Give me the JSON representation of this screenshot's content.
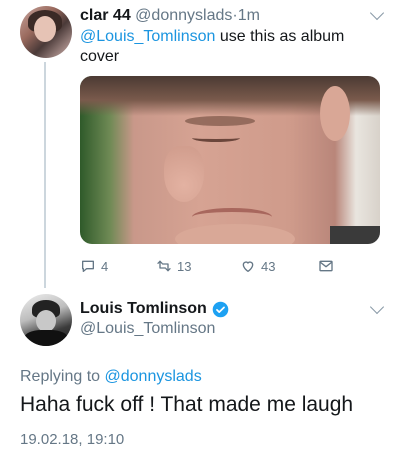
{
  "tweet1": {
    "name": "clar 44",
    "handle": "@donnyslads",
    "separator": "·",
    "time": "1m",
    "mention": "@Louis_Tomlinson",
    "text_line1_rest": " use this as album",
    "text_line2": "cover",
    "counts": {
      "reply": "4",
      "retweet": "13",
      "like": "43"
    }
  },
  "tweet2": {
    "name": "Louis Tomlinson",
    "handle": "@Louis_Tomlinson",
    "replying_prefix": "Replying to ",
    "replying_handle": "@donnyslads",
    "text": "Haha fuck off ! That made me laugh",
    "timestamp": "19.02.18, 19:10"
  },
  "icons": {
    "reply": "reply-icon",
    "retweet": "retweet-icon",
    "like": "heart-icon",
    "dm": "envelope-icon",
    "verified": "verified-badge-icon",
    "menu": "chevron-down-icon"
  },
  "colors": {
    "accent": "#1b95e0",
    "secondary_text": "#657786",
    "thread_line": "#ccd6dd",
    "verified": "#1da1f2"
  }
}
